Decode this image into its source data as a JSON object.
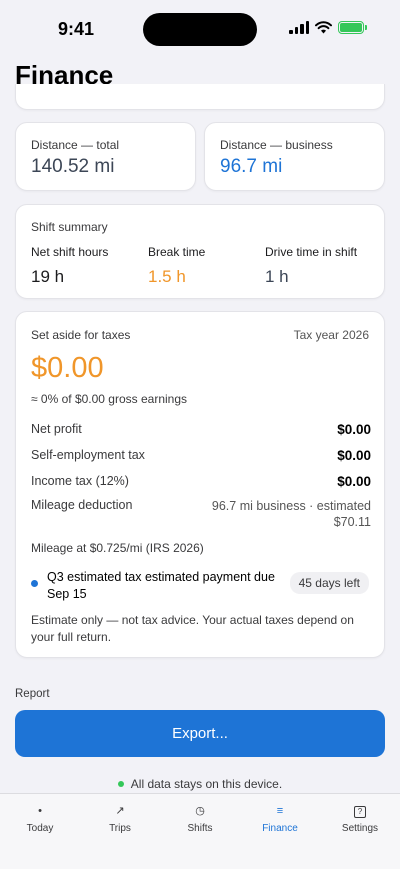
{
  "status": {
    "time": "9:41"
  },
  "page": {
    "title": "Finance"
  },
  "distance": {
    "total_label": "Distance — total",
    "total_value": "140.52 mi",
    "business_label": "Distance — business",
    "business_value": "96.7 mi"
  },
  "shift_summary": {
    "title": "Shift summary",
    "items": [
      {
        "label": "Net shift hours",
        "value": "19 h"
      },
      {
        "label": "Break time",
        "value": "1.5 h"
      },
      {
        "label": "Drive time in shift",
        "value": "1 h"
      }
    ]
  },
  "taxes": {
    "heading": "Set aside for taxes",
    "year": "Tax year 2026",
    "amount": "$0.00",
    "subtitle": "≈ 0% of $0.00 gross earnings",
    "rows": [
      {
        "label": "Net profit",
        "value": "$0.00"
      },
      {
        "label": "Self-employment tax",
        "value": "$0.00"
      },
      {
        "label": "Income tax (12%)",
        "value": "$0.00"
      }
    ],
    "mileage_deduction_label": "Mileage deduction",
    "mileage_deduction_value": "96.7 mi business · estimated $70.11",
    "mileage_rate": "Mileage at $0.725/mi (IRS 2026)",
    "due_text": "Q3 estimated tax estimated payment due Sep 15",
    "due_pill": "45 days left",
    "disclaimer": "Estimate only — not tax advice. Your actual taxes depend on your full return."
  },
  "report": {
    "label": "Report",
    "export_label": "Export...",
    "device_note": "All data stays on this device."
  },
  "tabs": [
    {
      "label": "Today",
      "icon": "dot-icon"
    },
    {
      "label": "Trips",
      "icon": "arrow-icon"
    },
    {
      "label": "Shifts",
      "icon": "clock-icon"
    },
    {
      "label": "Finance",
      "icon": "list-icon"
    },
    {
      "label": "Settings",
      "icon": "question-box-icon"
    }
  ],
  "colors": {
    "accent": "#1e74d6",
    "orange": "#f0962a",
    "green": "#34c759"
  }
}
